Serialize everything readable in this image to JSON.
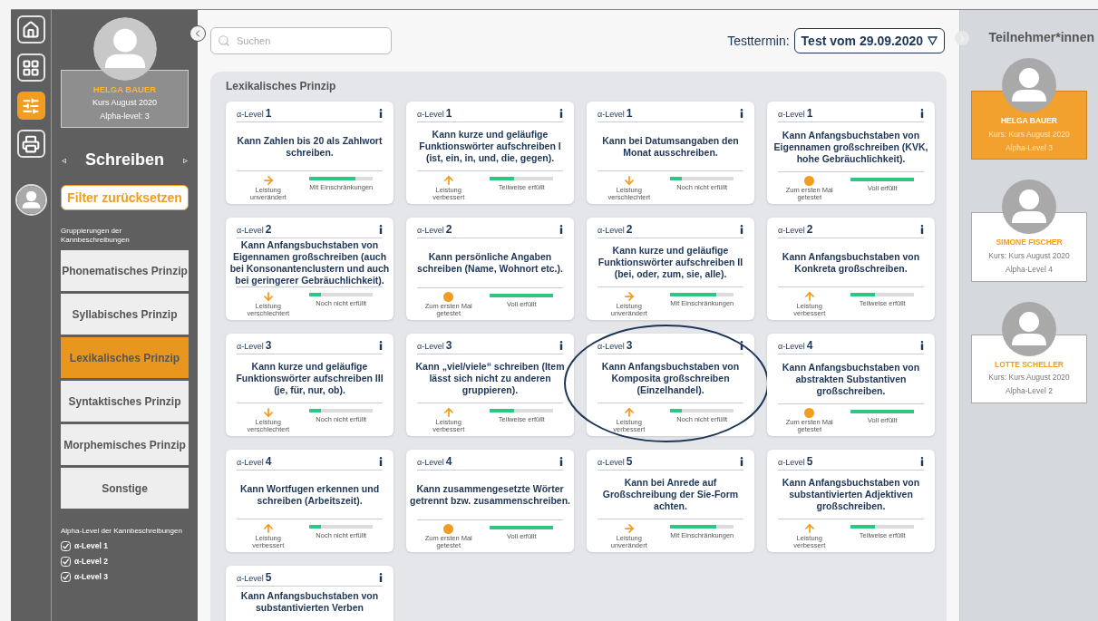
{
  "rail": {
    "items": [
      {
        "kind": "home",
        "selected": false
      },
      {
        "kind": "grid",
        "selected": false
      },
      {
        "kind": "filters",
        "selected": true
      },
      {
        "kind": "print",
        "selected": false
      }
    ]
  },
  "sidebar": {
    "profile": {
      "name": "HELGA BAUER",
      "course": "Kurs August 2020",
      "level": "Alpha-level: 3"
    },
    "section": "Schreiben",
    "prev": "◃",
    "next": "▹",
    "reset_button": "Filter zurücksetzen",
    "groups_label": "Gruppierungen der Kannbeschreibungen",
    "groups": [
      {
        "label": "Phonematisches Prinzip",
        "selected": false
      },
      {
        "label": "Syllabisches Prinzip",
        "selected": false
      },
      {
        "label": "Lexikalisches Prinzip",
        "selected": true
      },
      {
        "label": "Syntaktisches Prinzip",
        "selected": false
      },
      {
        "label": "Morphemisches Prinzip",
        "selected": false
      },
      {
        "label": "Sonstige",
        "selected": false
      }
    ],
    "levels_label": "Alpha-Level der Kannbeschreibungen",
    "levels": [
      {
        "label": "α-Level 1",
        "checked": true
      },
      {
        "label": "α-Level 2",
        "checked": true
      },
      {
        "label": "α-Level 3",
        "checked": true
      }
    ]
  },
  "header": {
    "search": {
      "placeholder": "Suchen"
    },
    "test_label": "Testtermin:",
    "test_value": "Test vom 29.09.2020"
  },
  "panel": {
    "title": "Lexikalisches Prinzip",
    "cards": [
      {
        "level_prefix": "α-Level",
        "level_number": "1",
        "text": "Kann Zahlen bis 20 als Zahlwort schreiben.",
        "highlighted": false,
        "trend": {
          "kind": "same",
          "label": "Leistung unverändert"
        },
        "fulfillment": {
          "level": 0.72,
          "label": "Mit Einschränkungen"
        }
      },
      {
        "level_prefix": "α-Level",
        "level_number": "1",
        "text": "Kann kurze und geläufige Funktionswörter aufschreiben I (ist, ein, in, und, die, gegen).",
        "highlighted": false,
        "trend": {
          "kind": "up",
          "label": "Leistung verbessert"
        },
        "fulfillment": {
          "level": 0.38,
          "label": "Teilweise erfüllt"
        }
      },
      {
        "level_prefix": "α-Level",
        "level_number": "1",
        "text": "Kann bei Datumsangaben den Monat ausschreiben.",
        "highlighted": false,
        "trend": {
          "kind": "down",
          "label": "Leistung verschlechtert"
        },
        "fulfillment": {
          "level": 0.18,
          "label": "Noch nicht erfüllt"
        }
      },
      {
        "level_prefix": "α-Level",
        "level_number": "1",
        "text": "Kann Anfangsbuchstaben von Eigennamen großschreiben (KVK, hohe Gebräuchlichkeit).",
        "highlighted": false,
        "trend": {
          "kind": "new",
          "label": "Zum ersten Mal getestet"
        },
        "fulfillment": {
          "level": 1,
          "label": "Voll erfüllt"
        }
      },
      {
        "level_prefix": "α-Level",
        "level_number": "2",
        "text": "Kann Anfangsbuchstaben von Eigennamen großschreiben (auch bei Konsonantenclustern und auch bei geringerer Gebräuchlichkeit).",
        "highlighted": false,
        "trend": {
          "kind": "down",
          "label": "Leistung verschlechtert"
        },
        "fulfillment": {
          "level": 0.18,
          "label": "Noch nicht erfüllt"
        }
      },
      {
        "level_prefix": "α-Level",
        "level_number": "2",
        "text": "Kann persönliche Angaben schreiben (Name, Wohnort etc.).",
        "highlighted": false,
        "trend": {
          "kind": "new",
          "label": "Zum ersten Mal getestet"
        },
        "fulfillment": {
          "level": 1,
          "label": "Voll erfüllt"
        }
      },
      {
        "level_prefix": "α-Level",
        "level_number": "2",
        "text": "Kann kurze und geläufige Funktionswörter aufschreiben II (bei, oder, zum, sie, alle).",
        "highlighted": false,
        "trend": {
          "kind": "same",
          "label": "Leistung unverändert"
        },
        "fulfillment": {
          "level": 0.72,
          "label": "Mit Einschränkungen"
        }
      },
      {
        "level_prefix": "α-Level",
        "level_number": "2",
        "text": "Kann Anfangsbuchstaben von Konkreta großschreiben.",
        "highlighted": false,
        "trend": {
          "kind": "up",
          "label": "Leistung verbessert"
        },
        "fulfillment": {
          "level": 0.38,
          "label": "Teilweise erfüllt"
        }
      },
      {
        "level_prefix": "α-Level",
        "level_number": "3",
        "text": "Kann kurze und geläufige Funktionswörter aufschreiben III (je, für, nur, ob).",
        "highlighted": false,
        "trend": {
          "kind": "down",
          "label": "Leistung verschlechtert"
        },
        "fulfillment": {
          "level": 0.18,
          "label": "Noch nicht erfüllt"
        }
      },
      {
        "level_prefix": "α-Level",
        "level_number": "3",
        "text": "Kann „viel/viele“ schreiben (Item lässt sich nicht zu anderen gruppieren).",
        "highlighted": false,
        "trend": {
          "kind": "up",
          "label": "Leistung verbessert"
        },
        "fulfillment": {
          "level": 0.38,
          "label": "Teilweise erfüllt"
        }
      },
      {
        "level_prefix": "α-Level",
        "level_number": "3",
        "text": "Kann Anfangsbuchstaben von Komposita großschreiben (Einzelhandel).",
        "highlighted": true,
        "trend": {
          "kind": "up",
          "label": "Leistung verbessert"
        },
        "fulfillment": {
          "level": 0.18,
          "label": "Noch nicht erfüllt"
        }
      },
      {
        "level_prefix": "α-Level",
        "level_number": "4",
        "text": "Kann Anfangsbuchstaben von abstrakten Substantiven großschreiben.",
        "highlighted": false,
        "trend": {
          "kind": "new",
          "label": "Zum ersten Mal getestet"
        },
        "fulfillment": {
          "level": 1,
          "label": "Voll erfüllt"
        }
      },
      {
        "level_prefix": "α-Level",
        "level_number": "4",
        "text": "Kann Wortfugen erkennen und schreiben (Arbeitszeit).",
        "highlighted": false,
        "trend": {
          "kind": "up",
          "label": "Leistung verbessert"
        },
        "fulfillment": {
          "level": 0.18,
          "label": "Noch nicht erfüllt"
        }
      },
      {
        "level_prefix": "α-Level",
        "level_number": "4",
        "text": "Kann zusammengesetzte Wörter getrennt bzw. zusammenschreiben.",
        "highlighted": false,
        "trend": {
          "kind": "new",
          "label": "Zum ersten Mal getestet"
        },
        "fulfillment": {
          "level": 1,
          "label": "Voll erfüllt"
        }
      },
      {
        "level_prefix": "α-Level",
        "level_number": "5",
        "text": "Kann bei Anrede auf Großschreibung der Sie-Form achten.",
        "highlighted": false,
        "trend": {
          "kind": "same",
          "label": "Leistung unverändert"
        },
        "fulfillment": {
          "level": 0.72,
          "label": "Mit Einschränkungen"
        }
      },
      {
        "level_prefix": "α-Level",
        "level_number": "5",
        "text": "Kann Anfangsbuchstaben von substantivierten Adjektiven großschreiben.",
        "highlighted": false,
        "trend": {
          "kind": "up",
          "label": "Leistung verbessert"
        },
        "fulfillment": {
          "level": 0.38,
          "label": "Teilweise erfüllt"
        }
      },
      {
        "level_prefix": "α-Level",
        "level_number": "5",
        "text": "Kann Anfangsbuchstaben von substantivierten Verben"
      }
    ]
  },
  "participants": {
    "title": "Teilnehmer*innen",
    "items": [
      {
        "name": "HELGA BAUER",
        "course": "Kurs: Kurs August 2020",
        "level": "Alpha-Level 3",
        "selected": true
      },
      {
        "name": "SIMONE FISCHER",
        "course": "Kurs: Kurs August 2020",
        "level": "Alpha-Level 4",
        "selected": false
      },
      {
        "name": "LOTTE SCHELLER",
        "course": "Kurs: Kurs August 2020",
        "level": "Alpha-Level 2",
        "selected": false
      }
    ]
  }
}
